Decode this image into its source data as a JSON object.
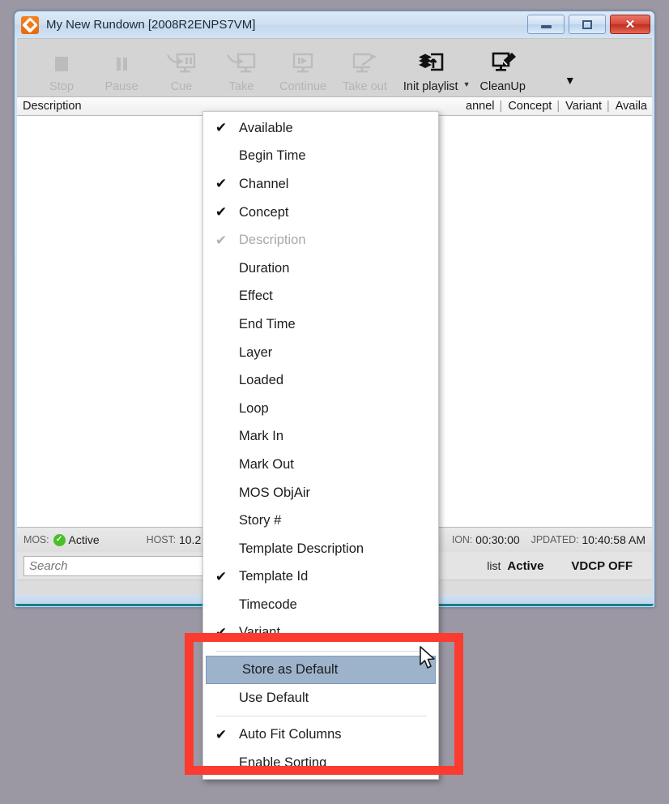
{
  "window": {
    "title": "My New Rundown [2008R2ENPS7VM]",
    "app_icon": "rundown-app-icon",
    "minimize_label": "Minimize",
    "maximize_label": "Maximize",
    "close_label": "Close"
  },
  "toolbar": {
    "items": [
      {
        "label": "Stop",
        "icon": "stop-icon",
        "enabled": false
      },
      {
        "label": "Pause",
        "icon": "pause-icon",
        "enabled": false
      },
      {
        "label": "Cue",
        "icon": "cue-icon",
        "enabled": false
      },
      {
        "label": "Take",
        "icon": "take-icon",
        "enabled": false
      },
      {
        "label": "Continue",
        "icon": "continue-icon",
        "enabled": false
      },
      {
        "label": "Take out",
        "icon": "take-out-icon",
        "enabled": false
      },
      {
        "label": "Init playlist",
        "icon": "init-playlist-icon",
        "enabled": true
      },
      {
        "label": "CleanUp",
        "icon": "cleanup-icon",
        "enabled": true
      }
    ],
    "dropdown_glyph": "▼",
    "overflow_glyph": "▼"
  },
  "grid": {
    "columns": [
      "Description",
      "annel",
      "Concept",
      "Variant",
      "Availa"
    ],
    "separator": "|",
    "rows": []
  },
  "status": {
    "mos_key": "MOS:",
    "mos_value": "Active",
    "mos_icon": "green-check-icon",
    "host_key": "HOST:",
    "host_value": "10.2",
    "duration_key": "ION:",
    "duration_value": "00:30:00",
    "updated_key": "JPDATED:",
    "updated_value": "10:40:58 AM"
  },
  "search": {
    "placeholder": "Search",
    "value": ""
  },
  "footer": {
    "playlist_label": "list",
    "playlist_state": "Active",
    "vdcp_state": "VDCP OFF"
  },
  "context_menu": {
    "checked_glyph": "✔",
    "items": [
      {
        "label": "Available",
        "checked": true,
        "enabled": true
      },
      {
        "label": "Begin Time",
        "checked": false,
        "enabled": true
      },
      {
        "label": "Channel",
        "checked": true,
        "enabled": true
      },
      {
        "label": "Concept",
        "checked": true,
        "enabled": true
      },
      {
        "label": "Description",
        "checked": true,
        "enabled": false
      },
      {
        "label": "Duration",
        "checked": false,
        "enabled": true
      },
      {
        "label": "Effect",
        "checked": false,
        "enabled": true
      },
      {
        "label": "End Time",
        "checked": false,
        "enabled": true
      },
      {
        "label": "Layer",
        "checked": false,
        "enabled": true
      },
      {
        "label": "Loaded",
        "checked": false,
        "enabled": true
      },
      {
        "label": "Loop",
        "checked": false,
        "enabled": true
      },
      {
        "label": "Mark In",
        "checked": false,
        "enabled": true
      },
      {
        "label": "Mark Out",
        "checked": false,
        "enabled": true
      },
      {
        "label": "MOS ObjAir",
        "checked": false,
        "enabled": true
      },
      {
        "label": "Story #",
        "checked": false,
        "enabled": true
      },
      {
        "label": "Template Description",
        "checked": false,
        "enabled": true
      },
      {
        "label": "Template Id",
        "checked": true,
        "enabled": true
      },
      {
        "label": "Timecode",
        "checked": false,
        "enabled": true
      },
      {
        "label": "Variant",
        "checked": true,
        "enabled": true
      },
      {
        "label": "Store as Default",
        "checked": false,
        "enabled": true,
        "selected": true
      },
      {
        "label": "Use Default",
        "checked": false,
        "enabled": true
      },
      {
        "label": "Auto Fit Columns",
        "checked": true,
        "enabled": true
      },
      {
        "label": "Enable Sorting",
        "checked": false,
        "enabled": true
      }
    ]
  },
  "annotation": {
    "highlight_color": "#fb3b2f",
    "cursor": "arrow-cursor"
  },
  "colors": {
    "accent": "#fb3b2f",
    "selection": "#9db3cb",
    "status_ok": "#49c02a",
    "app_icon": "#f58220",
    "desktop": "#9b98a4"
  }
}
